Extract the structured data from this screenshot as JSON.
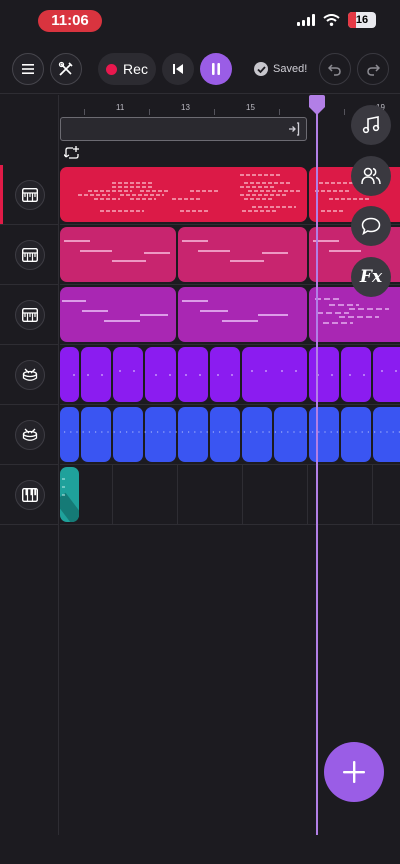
{
  "status_bar": {
    "time": "11:06",
    "battery": "16",
    "icons": [
      "signal-icon",
      "wifi-icon",
      "battery-icon"
    ]
  },
  "toolbar": {
    "rec_label": "Rec",
    "saved_label": "Saved!"
  },
  "ruler": {
    "ticks": [
      "11",
      "13",
      "15",
      "19"
    ]
  },
  "colors": {
    "accent": "#9a5de6",
    "playhead": "#b27fe6",
    "track1": "#dc1a47",
    "track2": "#c8256f",
    "track3": "#a927b3",
    "track4": "#8b1cf0",
    "track5": "#3a55f2",
    "track6": "#1fa19b"
  },
  "tracks": [
    {
      "icon": "keyboard-icon",
      "type": "instrument",
      "selected": true
    },
    {
      "icon": "keyboard-icon",
      "type": "instrument",
      "selected": false
    },
    {
      "icon": "keyboard-icon",
      "type": "instrument",
      "selected": false
    },
    {
      "icon": "drum-icon",
      "type": "drums",
      "selected": false
    },
    {
      "icon": "drum-icon",
      "type": "drums",
      "selected": false
    },
    {
      "icon": "piano-icon",
      "type": "instrument",
      "selected": false
    }
  ],
  "side_tools": [
    "music-note-icon",
    "collaborators-icon",
    "chat-icon",
    "effects-icon"
  ],
  "side_tools_fx_label": "Fx"
}
